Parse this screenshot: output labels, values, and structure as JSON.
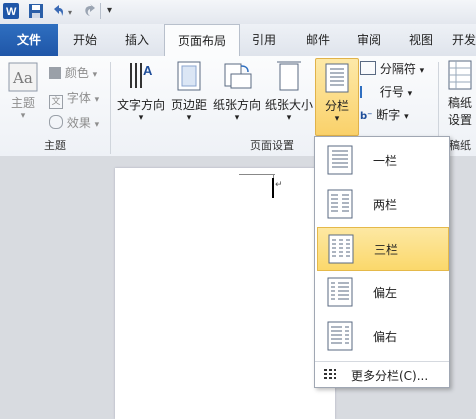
{
  "tabs": [
    "文件",
    "开始",
    "插入",
    "页面布局",
    "引用",
    "邮件",
    "审阅",
    "视图",
    "开发"
  ],
  "ribbon": {
    "themes_group": {
      "theme_label": "主题",
      "colors": "颜色",
      "fonts": "字体",
      "effects": "效果",
      "group_label": "主题"
    },
    "setup_group": {
      "text_direction": "文字方向",
      "margins": "页边距",
      "orientation": "纸张方向",
      "size": "纸张大小",
      "columns": "分栏",
      "breaks": "分隔符",
      "line_numbers": "行号",
      "hyphenation": "断字",
      "group_label": "页面设置"
    },
    "draft_group": {
      "line1": "稿纸",
      "line2": "设置",
      "group_label": "稿纸"
    }
  },
  "dropdown": {
    "items": [
      "一栏",
      "两栏",
      "三栏",
      "偏左",
      "偏右"
    ],
    "more": "更多分栏(C)...",
    "selected_index": 2
  },
  "colors": {
    "accent": "#1f56a8",
    "highlight": "#fbd86b"
  }
}
